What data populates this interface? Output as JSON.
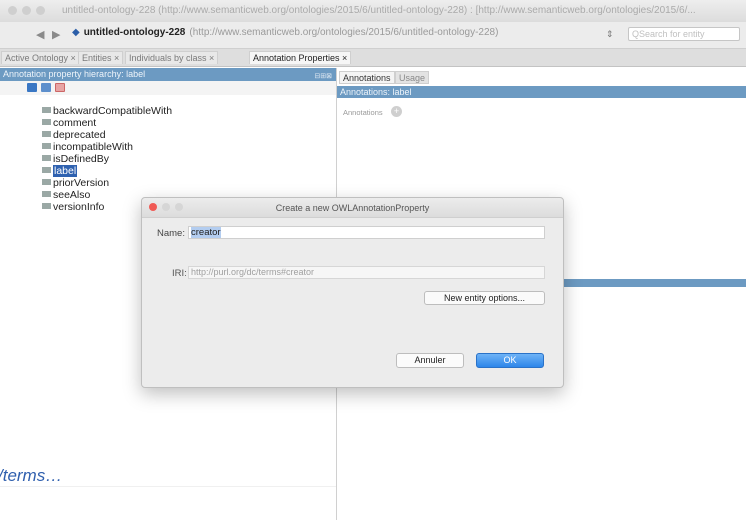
{
  "window": {
    "title": "untitled-ontology-228 (http://www.semanticweb.org/ontologies/2015/6/untitled-ontology-228) : [http://www.semanticweb.org/ontologies/2015/6/..."
  },
  "toolbar": {
    "back": "◀",
    "forward": "▶",
    "ontology_name": "untitled-ontology-228",
    "ontology_iri": "(http://www.semanticweb.org/ontologies/2015/6/untitled-ontology-228)",
    "spinner": "⇕",
    "search_placeholder": "Search for entity"
  },
  "tabs": [
    {
      "label": "Active Ontology ×"
    },
    {
      "label": "Entities ×"
    },
    {
      "label": "Individuals by class ×"
    },
    {
      "label": "Annotation Properties ×"
    }
  ],
  "left": {
    "header": "Annotation property hierarchy: label",
    "header_controls": "⊟⊞⊠",
    "items": [
      {
        "label": "backwardCompatibleWith"
      },
      {
        "label": "comment"
      },
      {
        "label": "deprecated"
      },
      {
        "label": "incompatibleWith"
      },
      {
        "label": "isDefinedBy"
      },
      {
        "label": "label"
      },
      {
        "label": "priorVersion"
      },
      {
        "label": "seeAlso"
      },
      {
        "label": "versionInfo"
      }
    ]
  },
  "right": {
    "tabs": [
      "Annotations",
      "Usage"
    ],
    "header": "Annotations: label",
    "annotations_label": "Annotations",
    "add": "+"
  },
  "dialog": {
    "title": "Create a new OWLAnnotationProperty",
    "name_label": "Name:",
    "name_value": "creator",
    "iri_label": "IRI:",
    "iri_value": "http://purl.org/dc/terms#creator",
    "new_entity_options": "New entity options...",
    "cancel": "Annuler",
    "ok": "OK"
  },
  "footer_fragment": "/terms…",
  "colors": {
    "header_blue": "#6c9ac2",
    "selection_blue": "#2f62b0",
    "ok_blue": "#2e86ea"
  }
}
